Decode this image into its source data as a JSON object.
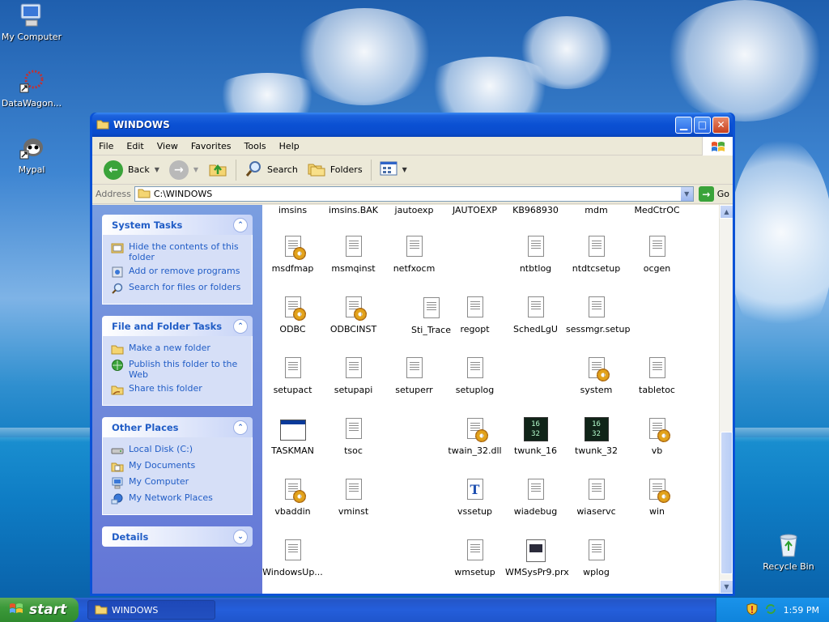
{
  "desktop": {
    "icons": [
      {
        "label": "My Computer",
        "icon": "my-computer-icon"
      },
      {
        "label": "DataWagon...",
        "icon": "datawagon-icon"
      },
      {
        "label": "Mypal",
        "icon": "mypal-icon"
      },
      {
        "label": "Recycle Bin",
        "icon": "recycle-bin-icon"
      }
    ]
  },
  "window": {
    "title": "WINDOWS",
    "menu": [
      "File",
      "Edit",
      "View",
      "Favorites",
      "Tools",
      "Help"
    ],
    "toolbar": {
      "back": "Back",
      "search": "Search",
      "folders": "Folders"
    },
    "address": {
      "label": "Address",
      "value": "C:\\WINDOWS",
      "go": "Go"
    }
  },
  "taskpane": {
    "system_tasks": {
      "title": "System Tasks",
      "items": [
        "Hide the contents of this folder",
        "Add or remove programs",
        "Search for files or folders"
      ]
    },
    "file_folder_tasks": {
      "title": "File and Folder Tasks",
      "items": [
        "Make a new folder",
        "Publish this folder to the Web",
        "Share this folder"
      ]
    },
    "other_places": {
      "title": "Other Places",
      "items": [
        "Local Disk (C:)",
        "My Documents",
        "My Computer",
        "My Network Places"
      ]
    },
    "details": {
      "title": "Details"
    }
  },
  "files": {
    "top_row": [
      "imsins",
      "imsins.BAK",
      "jautoexp",
      "JAUTOEXP",
      "KB968930",
      "mdm",
      "MedCtrOC"
    ],
    "items": [
      {
        "name": "msdfmap",
        "icon": "config-gear-icon"
      },
      {
        "name": "msmqinst",
        "icon": "text-document-icon"
      },
      {
        "name": "netfxocm",
        "icon": "text-document-icon"
      },
      {
        "name": "ntbtlog",
        "icon": "text-document-icon"
      },
      {
        "name": "ntdtcsetup",
        "icon": "text-document-icon"
      },
      {
        "name": "ocgen",
        "icon": "text-document-icon"
      },
      {
        "name": "ODBC",
        "icon": "config-gear-icon"
      },
      {
        "name": "ODBCINST",
        "icon": "config-gear-icon"
      },
      {
        "name": "Sti_Trace",
        "icon": "text-document-icon"
      },
      {
        "name": "regopt",
        "icon": "text-document-icon"
      },
      {
        "name": "SchedLgU",
        "icon": "text-document-icon"
      },
      {
        "name": "sessmgr.setup",
        "icon": "text-document-icon"
      },
      {
        "name": "setupact",
        "icon": "text-document-icon"
      },
      {
        "name": "setupapi",
        "icon": "text-document-icon"
      },
      {
        "name": "setuperr",
        "icon": "text-document-icon"
      },
      {
        "name": "setuplog",
        "icon": "text-document-icon"
      },
      {
        "name": "system",
        "icon": "config-gear-icon"
      },
      {
        "name": "tabletoc",
        "icon": "text-document-icon"
      },
      {
        "name": "TASKMAN",
        "icon": "application-icon"
      },
      {
        "name": "tsoc",
        "icon": "text-document-icon"
      },
      {
        "name": "twain_32.dll",
        "icon": "dll-gear-icon"
      },
      {
        "name": "twunk_16",
        "icon": "twunk-16-icon"
      },
      {
        "name": "twunk_32",
        "icon": "twunk-32-icon"
      },
      {
        "name": "vb",
        "icon": "config-gear-icon"
      },
      {
        "name": "vbaddin",
        "icon": "config-gear-icon"
      },
      {
        "name": "vminst",
        "icon": "text-document-icon"
      },
      {
        "name": "vssetup",
        "icon": "truetype-font-icon"
      },
      {
        "name": "wiadebug",
        "icon": "text-document-icon"
      },
      {
        "name": "wiaservc",
        "icon": "text-document-icon"
      },
      {
        "name": "win",
        "icon": "config-gear-icon"
      },
      {
        "name": "WindowsUp...",
        "icon": "text-document-icon"
      },
      {
        "name": "wmsetup",
        "icon": "text-document-icon"
      },
      {
        "name": "WMSysPr9.prx",
        "icon": "prx-file-icon"
      },
      {
        "name": "wplog",
        "icon": "text-document-icon"
      }
    ],
    "badge_16": "16",
    "badge_32": "32"
  },
  "taskbar": {
    "start": "start",
    "task": "WINDOWS",
    "clock": "1:59 PM"
  }
}
